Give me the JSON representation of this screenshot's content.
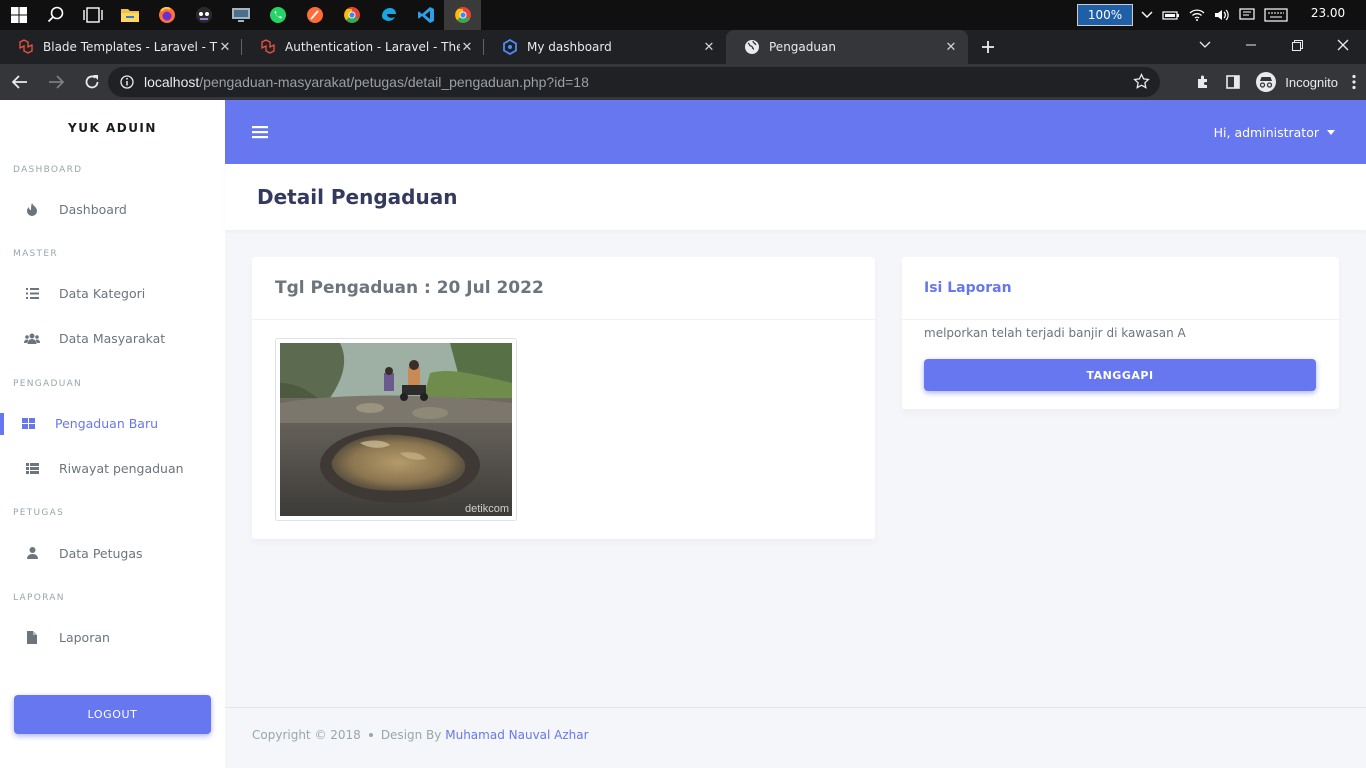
{
  "taskbar": {
    "zoom": "100%",
    "clock": "23.00",
    "pinned": [
      "windows-start-icon",
      "search-icon",
      "task-view-icon",
      "file-explorer-icon",
      "firefox-icon",
      "github-desktop-icon",
      "remote-desktop-icon",
      "whatsapp-icon",
      "postman-icon",
      "chrome-icon",
      "edge-dev-icon",
      "vscode-icon",
      "chrome-active-icon"
    ]
  },
  "browser": {
    "tabs": [
      {
        "title": "Blade Templates - Laravel - The P",
        "icon": "laravel-icon"
      },
      {
        "title": "Authentication - Laravel - The PH",
        "icon": "laravel-icon"
      },
      {
        "title": "My dashboard",
        "icon": "dashboard-hex-icon"
      },
      {
        "title": "Pengaduan",
        "icon": "globe-icon"
      }
    ],
    "url_host": "localhost",
    "url_path": "/pengaduan-masyarakat/petugas/detail_pengaduan.php?id=18",
    "profile": "Incognito"
  },
  "sidebar": {
    "brand": "YUK ADUIN",
    "sections": {
      "dashboard": "DASHBOARD",
      "master": "MASTER",
      "pengaduan": "PENGADUAN",
      "petugas": "PETUGAS",
      "laporan": "LAPORAN"
    },
    "items": {
      "dashboard": "Dashboard",
      "data_kategori": "Data Kategori",
      "data_masyarakat": "Data Masyarakat",
      "pengaduan_baru": "Pengaduan Baru",
      "riwayat_pengaduan": "Riwayat pengaduan",
      "data_petugas": "Data Petugas",
      "laporan": "Laporan"
    },
    "logout": "LOGOUT"
  },
  "topnav": {
    "user": "Hi, administrator"
  },
  "page": {
    "title": "Detail Pengaduan"
  },
  "detail_card": {
    "title": "Tgl Pengaduan : 20 Jul 2022",
    "photo_watermark": "detikcom"
  },
  "report_card": {
    "title": "Isi Laporan",
    "text": "melporkan telah terjadi banjir di kawasan A",
    "button": "TANGGAPI"
  },
  "footer": {
    "copyright": "Copyright © 2018",
    "design_by": "Design By",
    "author": "Muhamad Nauval Azhar"
  },
  "colors": {
    "primary": "#6777ef",
    "sidebar_bg": "#ffffff",
    "page_bg": "#f4f6f9"
  }
}
